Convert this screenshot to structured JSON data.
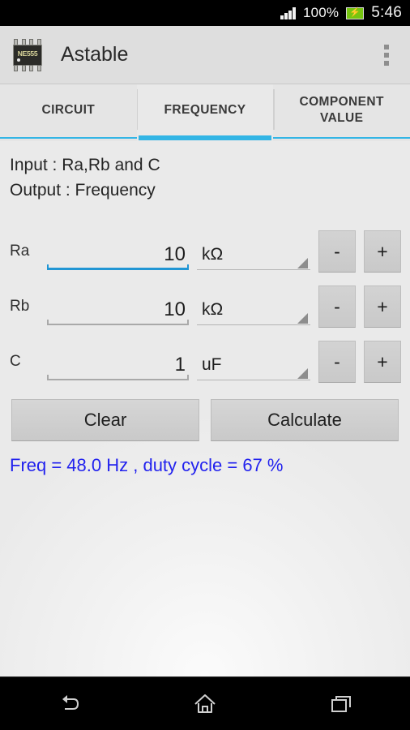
{
  "status_bar": {
    "signal_icon": "signal-bars-icon",
    "battery_percent": "100%",
    "battery_icon": "battery-charging-icon",
    "battery_bolt": "⚡",
    "time": "5:46"
  },
  "action_bar": {
    "app_icon": "ne555-chip-icon",
    "chip_label": "NE555",
    "title": "Astable",
    "overflow_icon": "overflow-menu-icon"
  },
  "tabs": [
    {
      "label": "CIRCUIT",
      "active": false
    },
    {
      "label": "FREQUENCY",
      "active": true
    },
    {
      "label": "COMPONENT VALUE",
      "active": false
    }
  ],
  "info": {
    "input_line": "Input : Ra,Rb and C",
    "output_line": "Output : Frequency"
  },
  "fields": [
    {
      "label": "Ra",
      "value": "10",
      "unit": "kΩ",
      "focused": true,
      "minus_label": "-",
      "plus_label": "+"
    },
    {
      "label": "Rb",
      "value": "10",
      "unit": "kΩ",
      "focused": false,
      "minus_label": "-",
      "plus_label": "+"
    },
    {
      "label": "C",
      "value": "1",
      "unit": "uF",
      "focused": false,
      "minus_label": "-",
      "plus_label": "+"
    }
  ],
  "buttons": {
    "clear_label": "Clear",
    "calculate_label": "Calculate"
  },
  "result": {
    "text": "Freq = 48.0 Hz , duty cycle = 67 %",
    "color": "#2222ee"
  },
  "nav_bar": {
    "back_icon": "back-arrow-icon",
    "home_icon": "home-icon",
    "recents_icon": "recents-icon"
  },
  "theme": {
    "accent": "#33b5e5",
    "focus_blue": "#2196d4",
    "action_bar_bg": "#dedede",
    "content_bg": "#eaeaea"
  }
}
